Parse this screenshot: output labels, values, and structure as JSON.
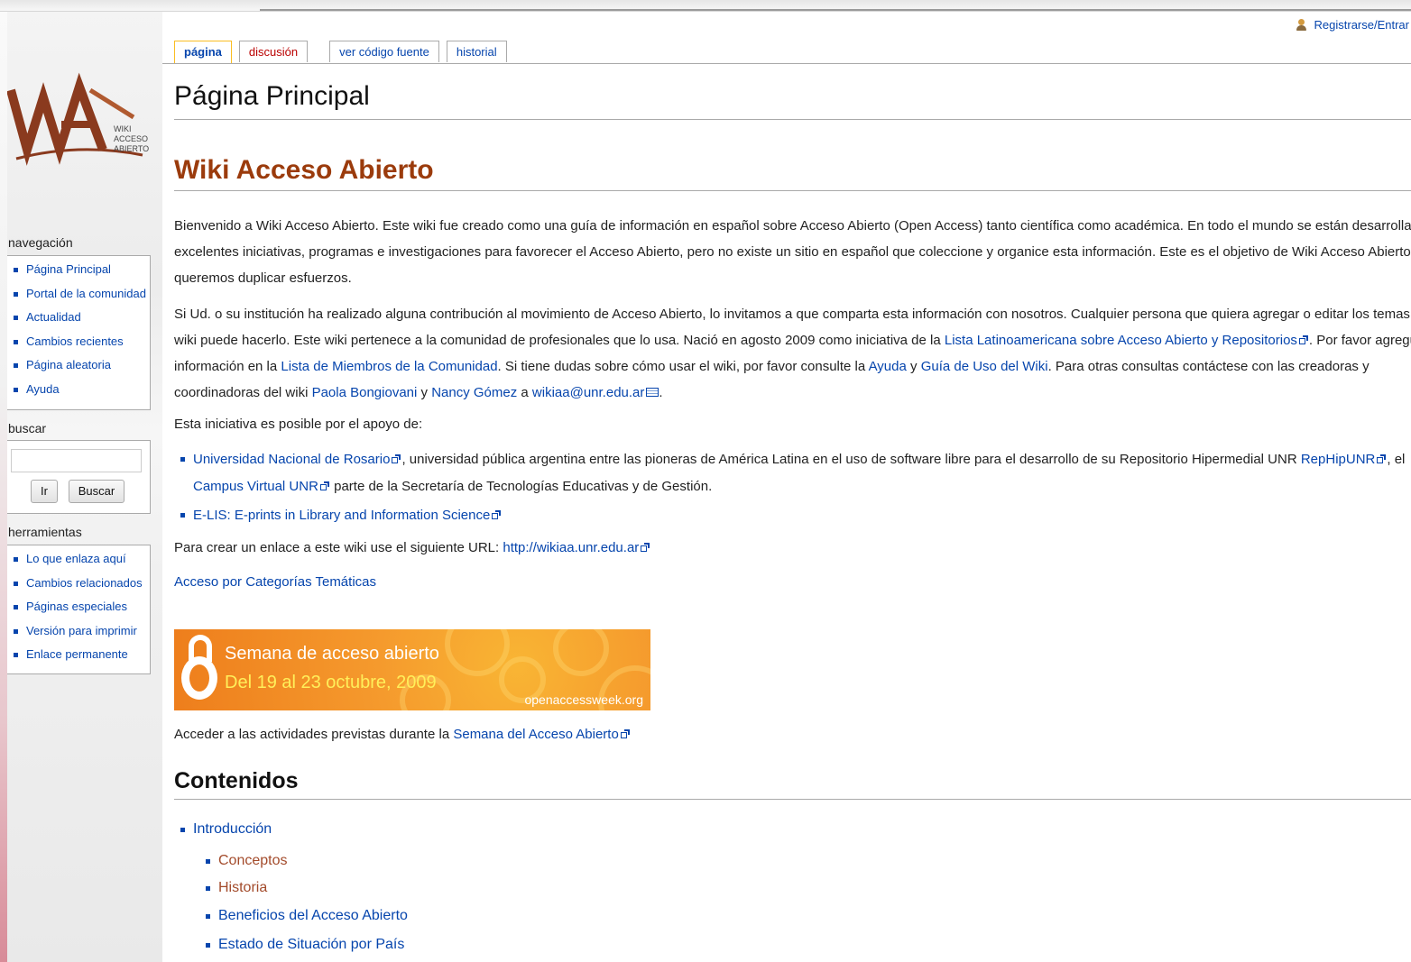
{
  "header": {
    "user_link": "Registrarse/Entrar"
  },
  "tabs": [
    {
      "label": "página"
    },
    {
      "label": "discusión"
    },
    {
      "label": "ver código fuente"
    },
    {
      "label": "historial"
    }
  ],
  "logo": {
    "text_lines": [
      "WIKI",
      "ACCESO",
      "ABIERTO"
    ]
  },
  "sidebar": {
    "nav_title": "navegación",
    "nav_items": [
      "Página Principal",
      "Portal de la comunidad",
      "Actualidad",
      "Cambios recientes",
      "Página aleatoria",
      "Ayuda"
    ],
    "search_title": "buscar",
    "search_value": "",
    "go_label": "Ir",
    "search_label": "Buscar",
    "tools_title": "herramientas",
    "tools_items": [
      "Lo que enlaza aquí",
      "Cambios relacionados",
      "Páginas especiales",
      "Versión para imprimir",
      "Enlace permanente"
    ]
  },
  "main": {
    "page_title": "Página Principal",
    "heading": "Wiki Acceso Abierto",
    "p1": [
      "Bienvenido a Wiki Acceso Abierto. Este wiki fue creado como una guía de información en español sobre Acceso Abierto (Open Access) tanto científica como académica. En todo el mundo se están desarrolland",
      "excelentes iniciativas, programas e investigaciones para favorecer el Acceso Abierto, pero no existe un sitio en español que coleccione y organice esta información. Este es el objetivo de Wiki Acceso Abierto. N",
      "queremos duplicar esfuerzos."
    ],
    "p2": {
      "l1": "Si Ud. o su institución ha realizado alguna contribución al movimiento de Acceso Abierto, lo invitamos a que comparta esta información con nosotros. Cualquier persona que quiera agregar o editar los temas del",
      "l2a": "wiki puede hacerlo. Este wiki pertenece a la comunidad de profesionales que lo usa. Nació en agosto 2009 como iniciativa de la ",
      "l2link": "Lista Latinoamericana sobre Acceso Abierto y Repositorios",
      "l2b": ". Por favor agregue s",
      "l3a": "información en la ",
      "l3link1": "Lista de Miembros de la Comunidad",
      "l3b": ". Si tiene dudas sobre cómo usar el wiki, por favor consulte la ",
      "l3link2": "Ayuda",
      "l3c": " y ",
      "l3link3": "Guía de Uso del Wiki",
      "l3d": ". Para otras consultas contáctese con las creadoras y",
      "l4a": "coordinadoras del wiki ",
      "l4link1": "Paola Bongiovani",
      "l4b": " y ",
      "l4link2": "Nancy Gómez",
      "l4c": " a ",
      "l4link3": "wikiaa@unr.edu.ar",
      "l4d": "."
    },
    "support_intro": "Esta iniciativa es posible por el apoyo de:",
    "support": {
      "b1link1": "Universidad Nacional de Rosario",
      "b1a": ", universidad pública argentina entre las pioneras de América Latina en el uso de software libre para el desarrollo de su Repositorio Hipermedial UNR ",
      "b1link2": "RepHipUNR",
      "b1b": ", el",
      "b1link3": "Campus Virtual UNR",
      "b1c": " parte de la Secretaría de Tecnologías Educativas y de Gestión.",
      "b2link": "E-LIS: E-prints in Library and Information Science"
    },
    "url_text": "Para crear un enlace a este wiki use el siguiente URL: ",
    "url_link": "http://wikiaa.unr.edu.ar",
    "categories_link": "Acceso por Categorías Temáticas",
    "banner": {
      "line1": "Semana de acceso abierto",
      "line2": "Del 19 al 23 octubre, 2009",
      "site": "openaccessweek.org"
    },
    "activities_text": "Acceder a las actividades previstas durante la ",
    "activities_link": "Semana del Acceso Abierto",
    "contents_heading": "Contenidos",
    "toc": {
      "l1": "Introducción",
      "l2": [
        "Conceptos",
        "Historia",
        "Beneficios del Acceso Abierto",
        "Estado de Situación por País"
      ]
    }
  }
}
